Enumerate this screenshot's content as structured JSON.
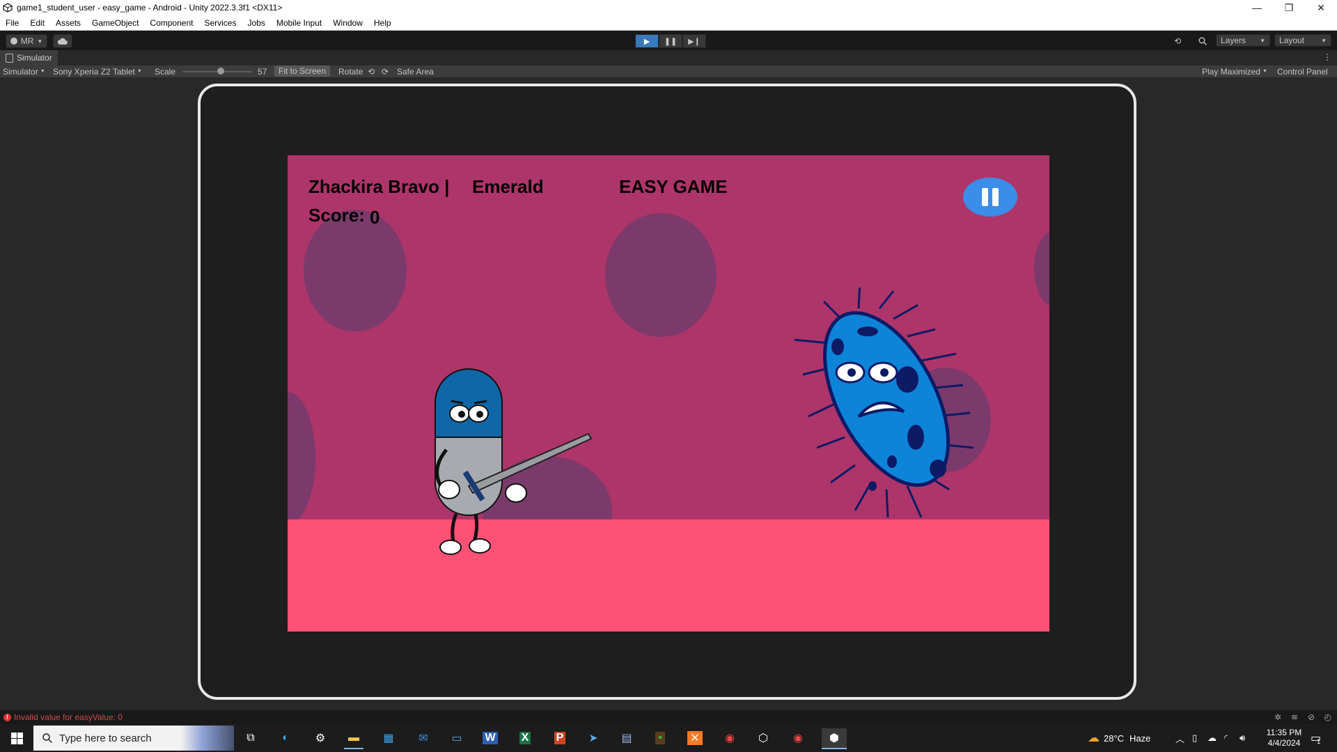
{
  "window": {
    "title": "game1_student_user - easy_game - Android - Unity 2022.3.3f1 <DX11>",
    "controls": [
      "—",
      "❐",
      "✕"
    ]
  },
  "menu": [
    "File",
    "Edit",
    "Assets",
    "GameObject",
    "Component",
    "Services",
    "Jobs",
    "Mobile Input",
    "Window",
    "Help"
  ],
  "toolbar": {
    "account_label": "MR",
    "layers_label": "Layers",
    "layout_label": "Layout"
  },
  "simulator": {
    "tab_label": "Simulator",
    "mode_label": "Simulator",
    "device_label": "Sony Xperia Z2 Tablet",
    "scale_label": "Scale",
    "scale_value": "57",
    "fit_label": "Fit to Screen",
    "rotate_label": "Rotate",
    "safe_area_label": "Safe Area",
    "play_mode_label": "Play Maximized",
    "control_panel_label": "Control Panel"
  },
  "game": {
    "player_name": "Zhackira Bravo |",
    "rank": "Emerald",
    "mode_title": "EASY GAME",
    "score_label": "Score:",
    "score_value": "0",
    "colors": {
      "sky": "#ae3569",
      "ground": "#fd5275",
      "blob": "#7b3a6b",
      "pause": "#3a8de8"
    }
  },
  "status": {
    "error_message": "Invalid value for easyValue: 0"
  },
  "taskbar": {
    "search_placeholder": "Type here to search",
    "weather_temp": "28°C",
    "weather_desc": "Haze",
    "time": "11:35 PM",
    "date": "4/4/2024",
    "notification_count": "1"
  }
}
